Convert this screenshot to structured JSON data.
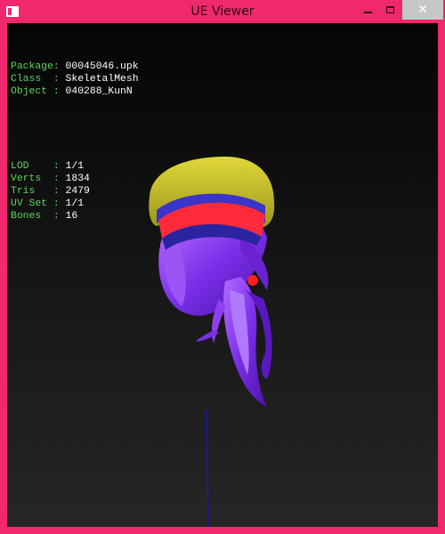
{
  "window": {
    "title": "UE Viewer",
    "close_label": "✕",
    "titlebar_color": "#f0286e"
  },
  "info": {
    "rows": [
      {
        "label": "Package:",
        "value": "00045046.upk"
      },
      {
        "label": "Class  :",
        "value": "SkeletalMesh"
      },
      {
        "label": "Object :",
        "value": "040288_KunN"
      }
    ],
    "stats": [
      {
        "label": "LOD    :",
        "value": "1/1"
      },
      {
        "label": "Verts  :",
        "value": "1834"
      },
      {
        "label": "Tris   :",
        "value": "2479"
      },
      {
        "label": "UV Set :",
        "value": "1/1"
      },
      {
        "label": "Bones  :",
        "value": "16"
      }
    ]
  },
  "colors": {
    "label": "#5fd35f",
    "value": "#ffffff",
    "hat_brim": "#c9c223",
    "hat_band_blue": "#3a34c8",
    "hat_band_red": "#ff2a3a",
    "hair": "#8a3cf0",
    "axis": "#1a1ab0"
  }
}
